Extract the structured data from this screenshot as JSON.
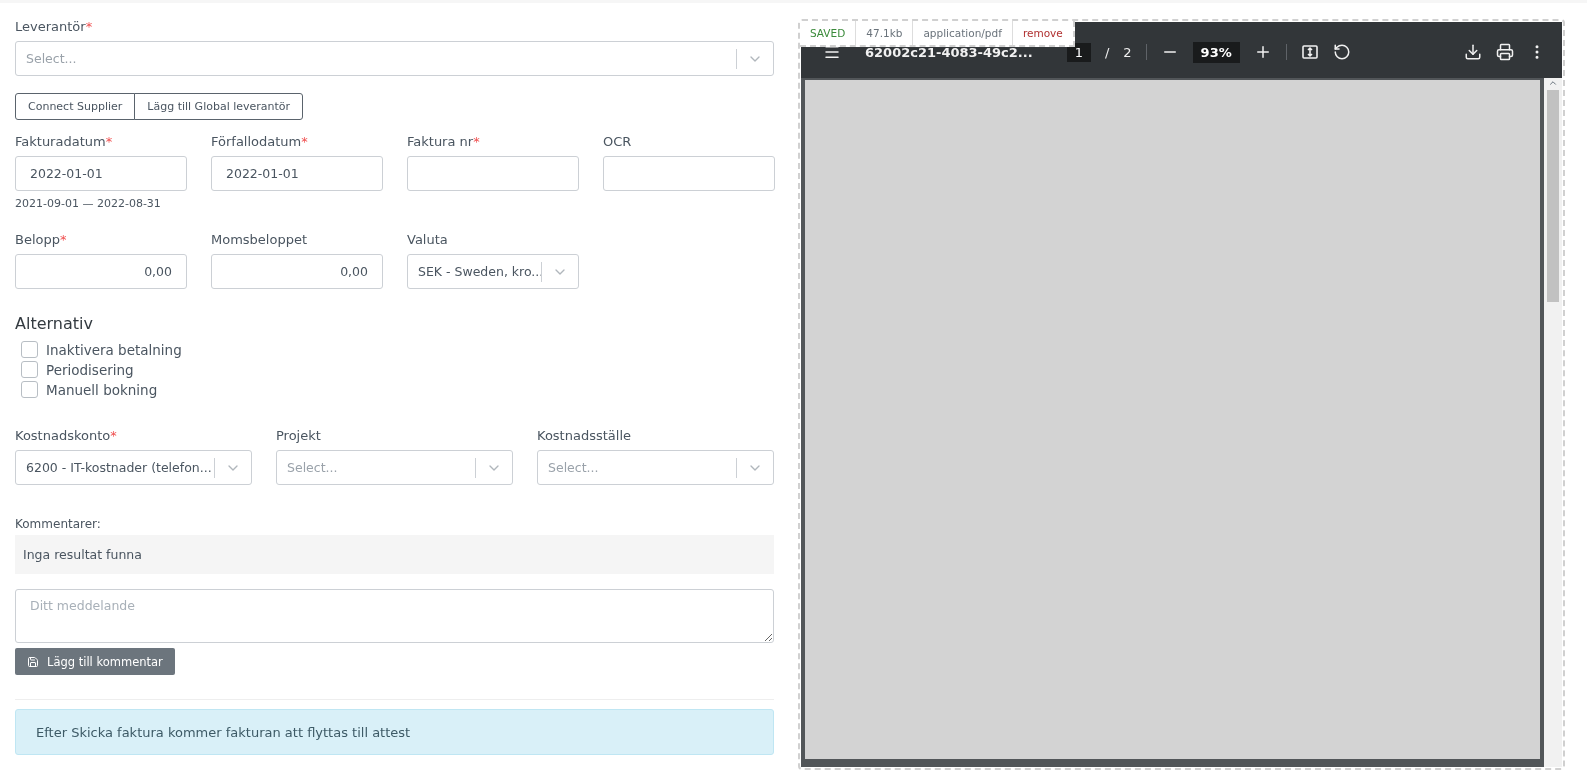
{
  "required_mark": "*",
  "supplier": {
    "label": "Leverantör",
    "required": true,
    "placeholder": "Select..."
  },
  "supplier_buttons": [
    "Connect Supplier",
    "Lägg till Global leverantör"
  ],
  "invoice_fields": [
    {
      "kind": "input",
      "label": "Fakturadatum",
      "required": true,
      "value": "2022-01-01",
      "hint": "2021-09-01 — 2022-08-31"
    },
    {
      "kind": "input",
      "label": "Förfallodatum",
      "required": true,
      "value": "2022-01-01"
    },
    {
      "kind": "input",
      "label": "Faktura nr",
      "required": true
    },
    {
      "kind": "input",
      "label": "OCR",
      "required": false
    }
  ],
  "amount_fields": [
    {
      "kind": "number",
      "label": "Belopp",
      "required": true,
      "value": "0,00"
    },
    {
      "kind": "number",
      "label": "Momsbeloppet",
      "required": false,
      "value": "0,00"
    },
    {
      "kind": "select",
      "label": "Valuta",
      "required": false,
      "value": "SEK - Sweden, kro..."
    }
  ],
  "options": {
    "title": "Alternativ",
    "checkboxes": [
      {
        "label": "Inaktivera betalning",
        "checked": false
      },
      {
        "label": "Periodisering",
        "checked": false
      },
      {
        "label": "Manuell bokning",
        "checked": false
      }
    ]
  },
  "accounting": [
    {
      "label": "Kostnadskonto",
      "required": true,
      "value": "6200 - IT-kostnader (telefon..."
    },
    {
      "label": "Projekt",
      "required": false,
      "placeholder": "Select..."
    },
    {
      "label": "Kostnadsställe",
      "required": false,
      "placeholder": "Select..."
    }
  ],
  "comments": {
    "label": "Kommentarer:",
    "empty_text": "Inga resultat funna",
    "message_placeholder": "Ditt meddelande",
    "button": "Lägg till kommentar"
  },
  "alert": "Efter Skicka faktura kommer fakturan att flyttas till attest",
  "pdf_viewer": {
    "file_tags": [
      {
        "kind": "status",
        "label": "SAVED"
      },
      {
        "kind": "info",
        "label": "47.1kb"
      },
      {
        "kind": "info",
        "label": "application/pdf"
      },
      {
        "kind": "action",
        "label": "remove"
      }
    ],
    "filename": "62002c21-4083-49c2...",
    "page": "1",
    "page_separator": "/",
    "page_total": "2",
    "zoom": "93%"
  }
}
